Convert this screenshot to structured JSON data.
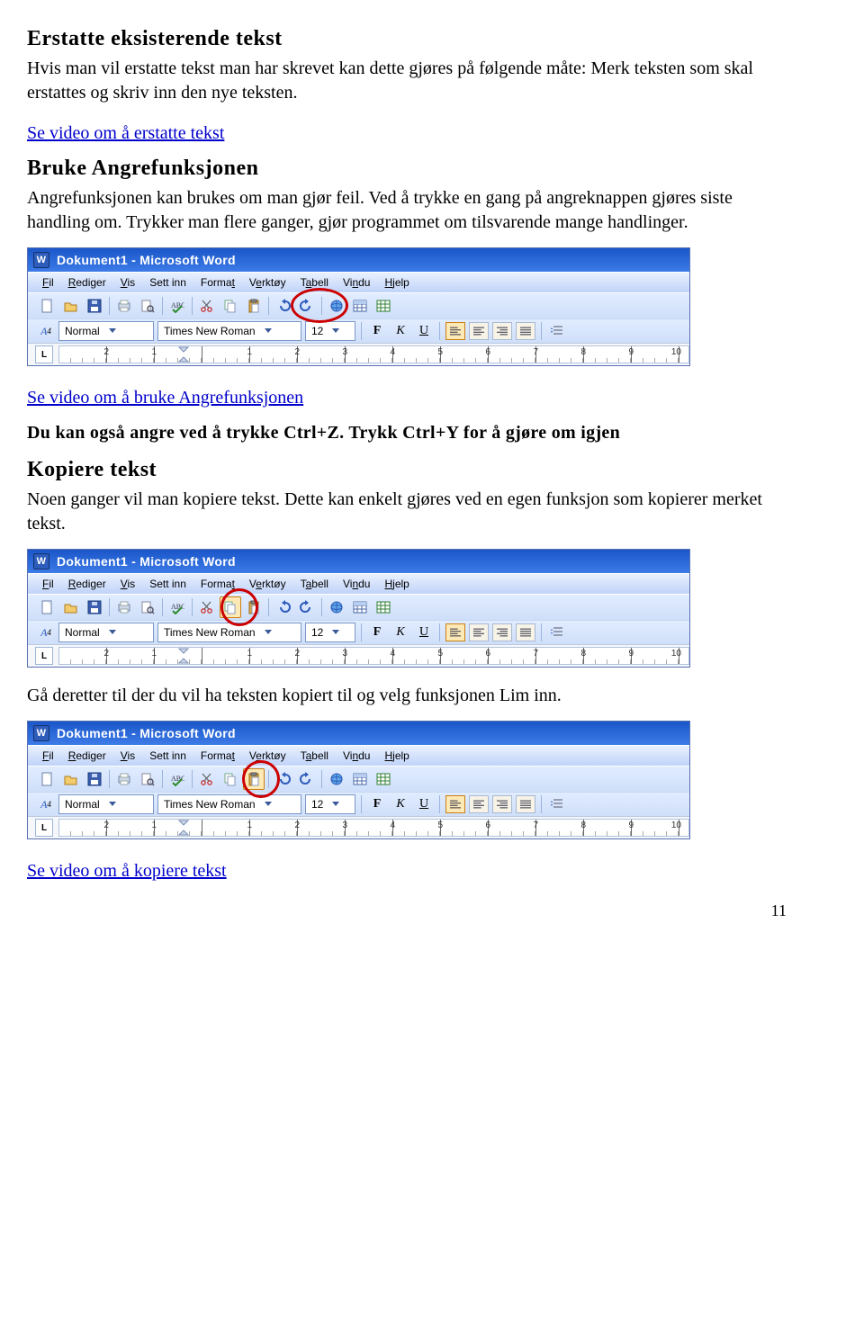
{
  "doc": {
    "h_erstatte": "Erstatte eksisterende tekst",
    "p_erstatte": "Hvis man vil erstatte tekst man har skrevet kan dette gjøres på følgende måte: Merk teksten som skal erstattes og skriv inn den nye teksten.",
    "link_erstatte": "Se video om å erstatte tekst",
    "h_angre": "Bruke Angrefunksjonen",
    "p_angre": "Angrefunksjonen kan brukes om man gjør feil. Ved å trykke en gang på angreknappen gjøres siste handling om. Trykker man flere ganger, gjør programmet om tilsvarende mange handlinger.",
    "link_angre": "Se video om å bruke Angrefunksjonen",
    "p_shortcut": "Du kan også angre ved å trykke Ctrl+Z. Trykk Ctrl+Y for å gjøre om igjen",
    "h_kopi": "Kopiere tekst",
    "p_kopi": "Noen ganger vil man kopiere tekst. Dette kan enkelt gjøres ved en egen funksjon som kopierer merket tekst.",
    "p_lim": "Gå deretter til der du vil ha teksten kopiert til og velg funksjonen Lim inn.",
    "link_kopi": "Se video om å kopiere tekst",
    "pagenum": "11"
  },
  "word": {
    "title": "Dokument1 - Microsoft Word",
    "menus": {
      "fil": "Fil",
      "rediger": "Rediger",
      "vis": "Vis",
      "settinn": "Sett inn",
      "format": "Format",
      "verktoy": "Verktøy",
      "tabell": "Tabell",
      "vindu": "Vindu",
      "hjelp": "Hjelp"
    },
    "style": "Normal",
    "font": "Times New Roman",
    "size": "12",
    "ruler_marks": [
      "2",
      "1",
      "",
      "1",
      "2",
      "3",
      "4",
      "5",
      "6",
      "7",
      "8",
      "9",
      "10"
    ],
    "fmt": {
      "bold": "F",
      "italic": "K",
      "underline": "U"
    },
    "ruler_corner": "L"
  }
}
